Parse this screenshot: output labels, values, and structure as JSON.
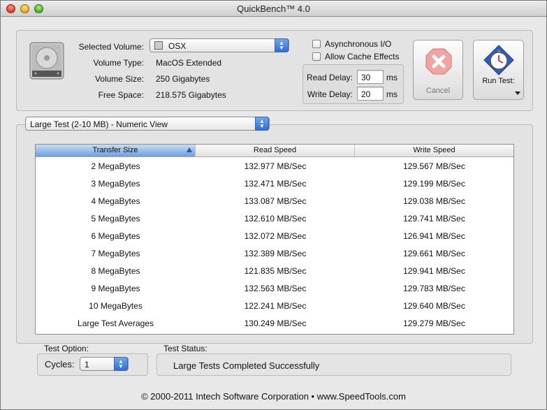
{
  "window": {
    "title": "QuickBench™ 4.0"
  },
  "volume": {
    "selected_label": "Selected Volume:",
    "selected_value": "OSX",
    "type_label": "Volume Type:",
    "type_value": "MacOS Extended",
    "size_label": "Volume Size:",
    "size_value": "250 Gigabytes",
    "free_label": "Free Space:",
    "free_value": "218.575 Gigabytes"
  },
  "options": {
    "async_label": "Asynchronous I/O",
    "cache_label": "Allow Cache Effects",
    "read_delay_label": "Read Delay:",
    "read_delay_value": "30",
    "write_delay_label": "Write Delay:",
    "write_delay_value": "20",
    "unit": "ms"
  },
  "buttons": {
    "cancel_label": "Cancel",
    "run_label": "Run Test:"
  },
  "view_select": {
    "value": "Large Test (2-10 MB) - Numeric View"
  },
  "table": {
    "columns": [
      "Transfer Size",
      "Read Speed",
      "Write Speed"
    ],
    "rows": [
      [
        "2 MegaBytes",
        "132.977 MB/Sec",
        "129.567 MB/Sec"
      ],
      [
        "3 MegaBytes",
        "132.471 MB/Sec",
        "129.199 MB/Sec"
      ],
      [
        "4 MegaBytes",
        "133.087 MB/Sec",
        "129.038 MB/Sec"
      ],
      [
        "5 MegaBytes",
        "132.610 MB/Sec",
        "129.741 MB/Sec"
      ],
      [
        "6 MegaBytes",
        "132.072 MB/Sec",
        "126.941 MB/Sec"
      ],
      [
        "7 MegaBytes",
        "132.389 MB/Sec",
        "129.661 MB/Sec"
      ],
      [
        "8 MegaBytes",
        "121.835 MB/Sec",
        "129.941 MB/Sec"
      ],
      [
        "9 MegaBytes",
        "132.563 MB/Sec",
        "129.783 MB/Sec"
      ],
      [
        "10 MegaBytes",
        "122.241 MB/Sec",
        "129.640 MB/Sec"
      ],
      [
        "Large Test Averages",
        "130.249 MB/Sec",
        "129.279 MB/Sec"
      ]
    ]
  },
  "test_option": {
    "label": "Test Option:",
    "cycles_label": "Cycles:",
    "cycles_value": "1"
  },
  "test_status": {
    "label": "Test Status:",
    "value": "Large Tests Completed Successfully"
  },
  "footer": {
    "text": "© 2000-2011 Intech Software Corporation • www.SpeedTools.com"
  }
}
